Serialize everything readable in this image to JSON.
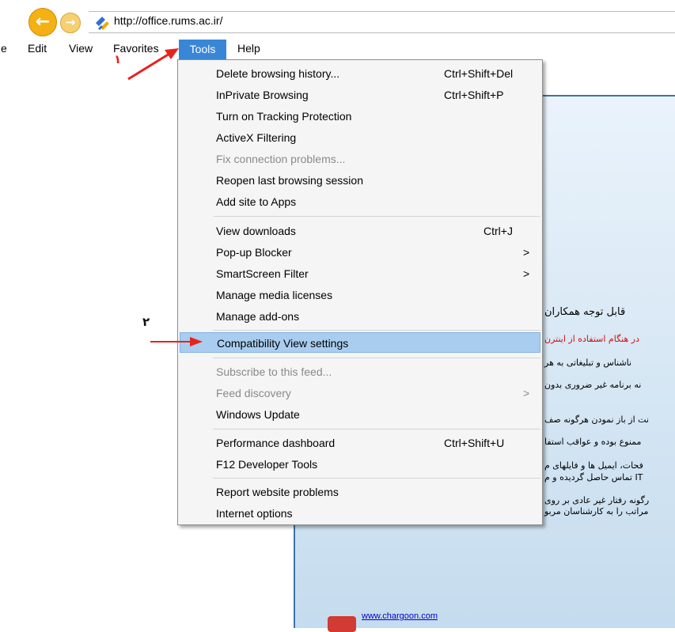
{
  "address_bar": {
    "url": "http://office.rums.ac.ir/"
  },
  "menubar": {
    "items": [
      {
        "label": "e"
      },
      {
        "label": "Edit"
      },
      {
        "label": "View"
      },
      {
        "label": "Favorites"
      },
      {
        "label": "Tools"
      },
      {
        "label": "Help"
      }
    ]
  },
  "tools_menu": {
    "items": [
      {
        "label": "Delete browsing history...",
        "shortcut": "Ctrl+Shift+Del"
      },
      {
        "label": "InPrivate Browsing",
        "shortcut": "Ctrl+Shift+P"
      },
      {
        "label": "Turn on Tracking Protection"
      },
      {
        "label": "ActiveX Filtering"
      },
      {
        "label": "Fix connection problems...",
        "disabled": true
      },
      {
        "label": "Reopen last browsing session"
      },
      {
        "label": "Add site to Apps"
      },
      {
        "label": "View downloads",
        "shortcut": "Ctrl+J"
      },
      {
        "label": "Pop-up Blocker",
        "submenu": ">"
      },
      {
        "label": "SmartScreen Filter",
        "submenu": ">"
      },
      {
        "label": "Manage media licenses"
      },
      {
        "label": "Manage add-ons"
      },
      {
        "label": "Compatibility View settings",
        "highlighted": true
      },
      {
        "label": "Subscribe to this feed...",
        "disabled": true
      },
      {
        "label": "Feed discovery",
        "disabled": true,
        "submenu": ">"
      },
      {
        "label": "Windows Update"
      },
      {
        "label": "Performance dashboard",
        "shortcut": "Ctrl+Shift+U"
      },
      {
        "label": "F12 Developer Tools"
      },
      {
        "label": "Report website problems"
      },
      {
        "label": "Internet options"
      }
    ]
  },
  "annotations": {
    "step1": "۱",
    "step2": "۲",
    "arrow_color": "#e8221c"
  },
  "page": {
    "lines": [
      "قابل توجه همکاران",
      "در هنگام استفاده از اینترن",
      "ناشناس و تبلیغاتی به هر",
      "نه برنامه غیر ضروری بدون",
      "نت از باز نمودن هرگونه صف",
      "ممنوع بوده و عواقب استفا",
      "فحات، ایمیل ها و فایلهای م",
      "IT تماس حاصل گردیده و م",
      "رگونه رفتار غیر عادی بر روی",
      "مراتب را به کارشناسان مربو"
    ],
    "footer_link": "www.chargoon.com"
  }
}
